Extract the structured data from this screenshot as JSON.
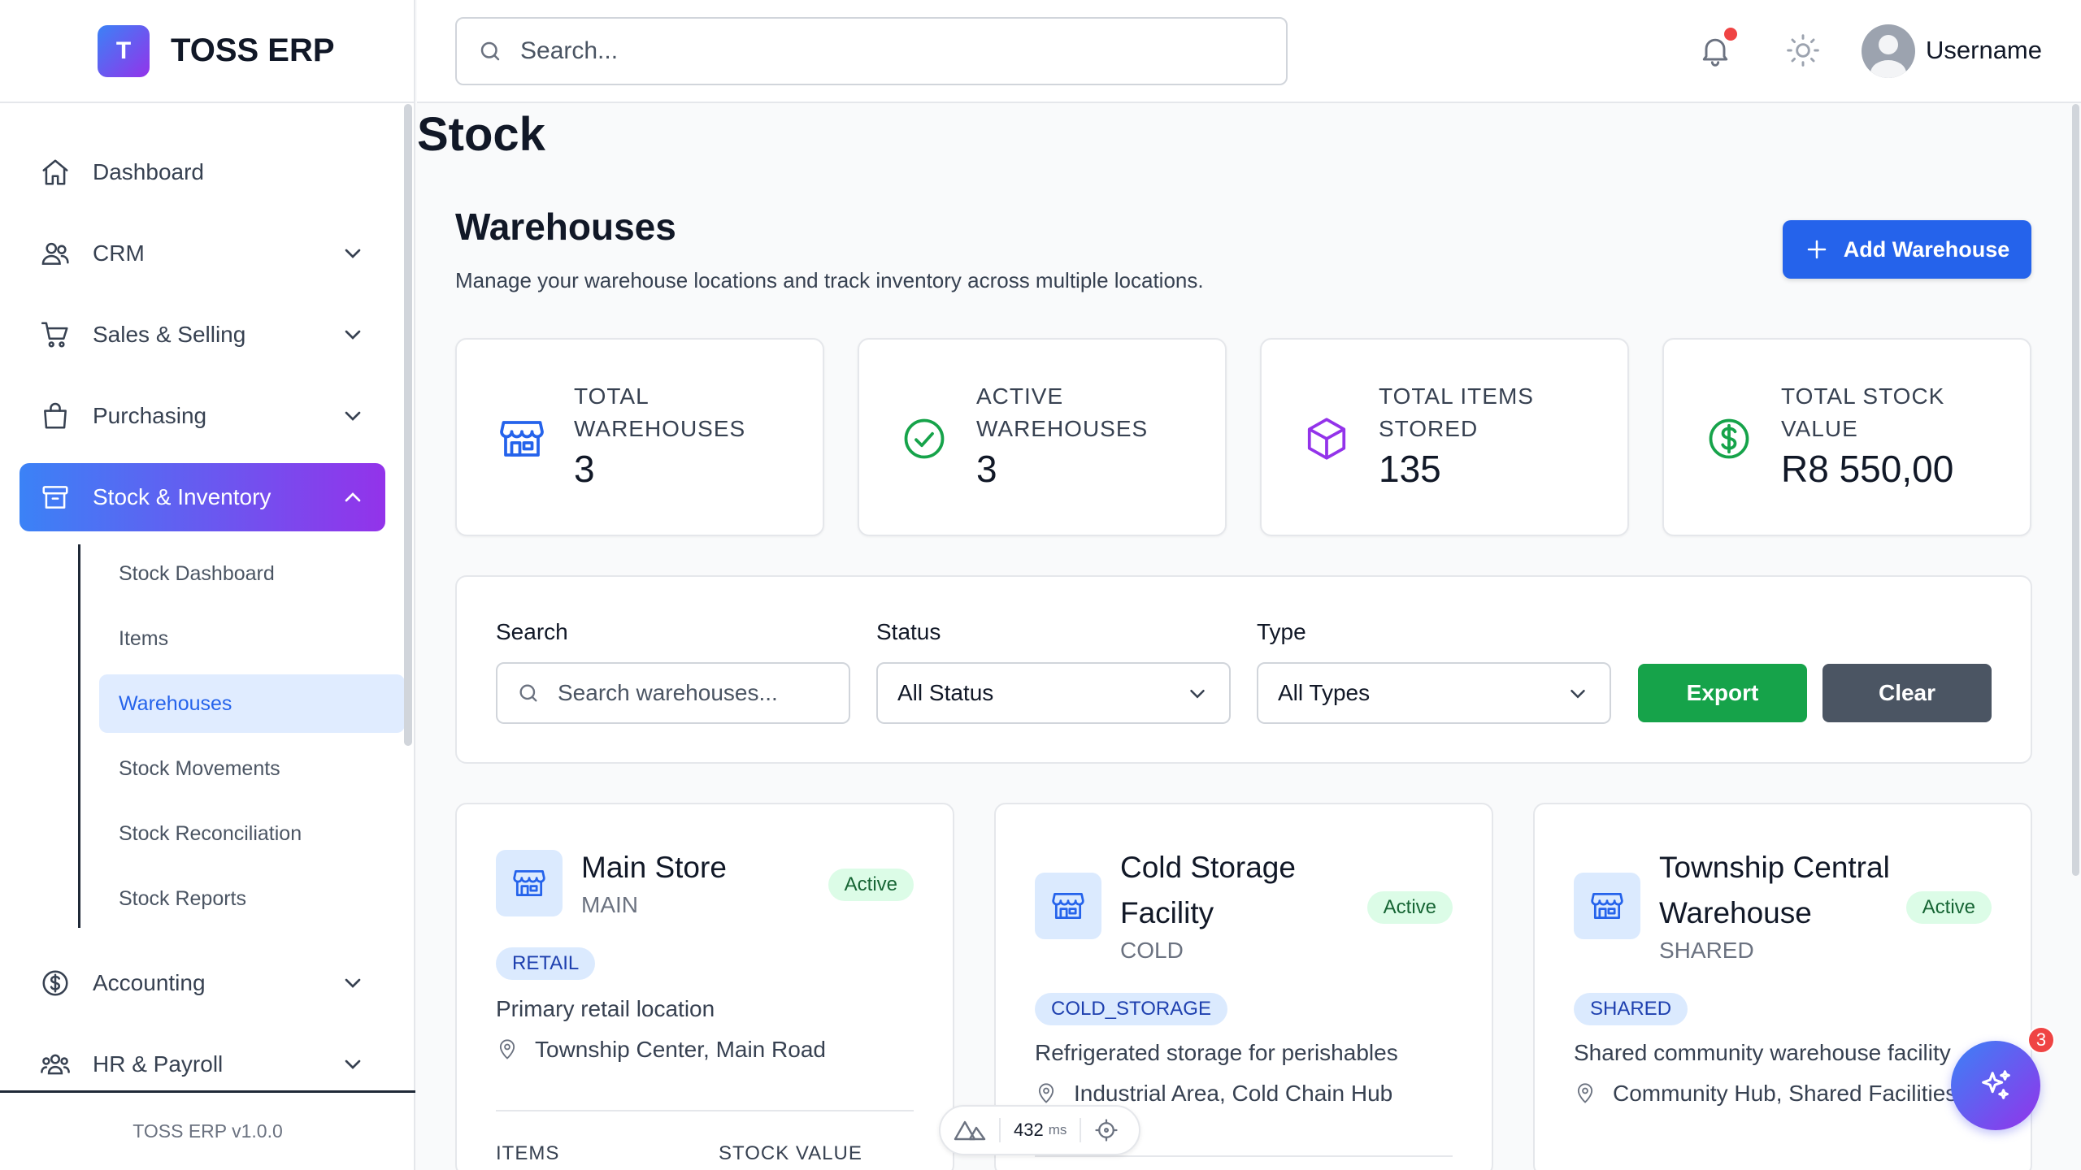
{
  "brand": {
    "logo_letter": "T",
    "name": "TOSS ERP",
    "version": "TOSS ERP v1.0.0"
  },
  "sidebar": {
    "items": [
      {
        "label": "Dashboard",
        "icon": "home-icon"
      },
      {
        "label": "CRM",
        "icon": "users-icon",
        "expandable": true
      },
      {
        "label": "Sales & Selling",
        "icon": "cart-icon",
        "expandable": true
      },
      {
        "label": "Purchasing",
        "icon": "bag-icon",
        "expandable": true
      },
      {
        "label": "Stock & Inventory",
        "icon": "archive-icon",
        "expandable": true,
        "active": true
      },
      {
        "label": "Accounting",
        "icon": "dollar-icon",
        "expandable": true
      },
      {
        "label": "HR & Payroll",
        "icon": "team-icon",
        "expandable": true
      }
    ],
    "sub_items": [
      "Stock Dashboard",
      "Items",
      "Warehouses",
      "Stock Movements",
      "Stock Reconciliation",
      "Stock Reports"
    ],
    "active_sub": "Warehouses"
  },
  "topbar": {
    "search_placeholder": "Search...",
    "username": "Username"
  },
  "page": {
    "title": "Stock",
    "section_title": "Warehouses",
    "section_subtitle": "Manage your warehouse locations and track inventory across multiple locations.",
    "add_button": "Add Warehouse"
  },
  "stats": [
    {
      "label_1": "TOTAL",
      "label_2": "WAREHOUSES",
      "value": "3",
      "icon": "store-icon",
      "color": "#2563eb"
    },
    {
      "label_1": "ACTIVE",
      "label_2": "WAREHOUSES",
      "value": "3",
      "icon": "check-circle-icon",
      "color": "#16a34a"
    },
    {
      "label_1": "TOTAL ITEMS",
      "label_2": "STORED",
      "value": "135",
      "icon": "cube-icon",
      "color": "#9333ea"
    },
    {
      "label_1": "TOTAL STOCK",
      "label_2": "VALUE",
      "value": "R8 550,00",
      "icon": "dollar-circle-icon",
      "color": "#16a34a"
    }
  ],
  "filters": {
    "search_label": "Search",
    "search_placeholder": "Search warehouses...",
    "status_label": "Status",
    "status_value": "All Status",
    "type_label": "Type",
    "type_value": "All Types",
    "export_label": "Export",
    "clear_label": "Clear"
  },
  "warehouses": [
    {
      "title_1": "Main Store",
      "title_2": "",
      "code": "MAIN",
      "status": "Active",
      "type": "RETAIL",
      "description": "Primary retail location",
      "location": "Township Center, Main Road",
      "items_label": "ITEMS",
      "value_label": "STOCK VALUE"
    },
    {
      "title_1": "Cold Storage",
      "title_2": "Facility",
      "code": "COLD",
      "status": "Active",
      "type": "COLD_STORAGE",
      "description": "Refrigerated storage for perishables",
      "location": "Industrial Area, Cold Chain Hub"
    },
    {
      "title_1": "Township Central",
      "title_2": "Warehouse",
      "code": "SHARED",
      "status": "Active",
      "type": "SHARED",
      "description": "Shared community warehouse facility",
      "location": "Community Hub, Shared Facilities"
    }
  ],
  "devbar": {
    "value": "432",
    "unit": "ms"
  },
  "fab": {
    "badge": "3"
  }
}
